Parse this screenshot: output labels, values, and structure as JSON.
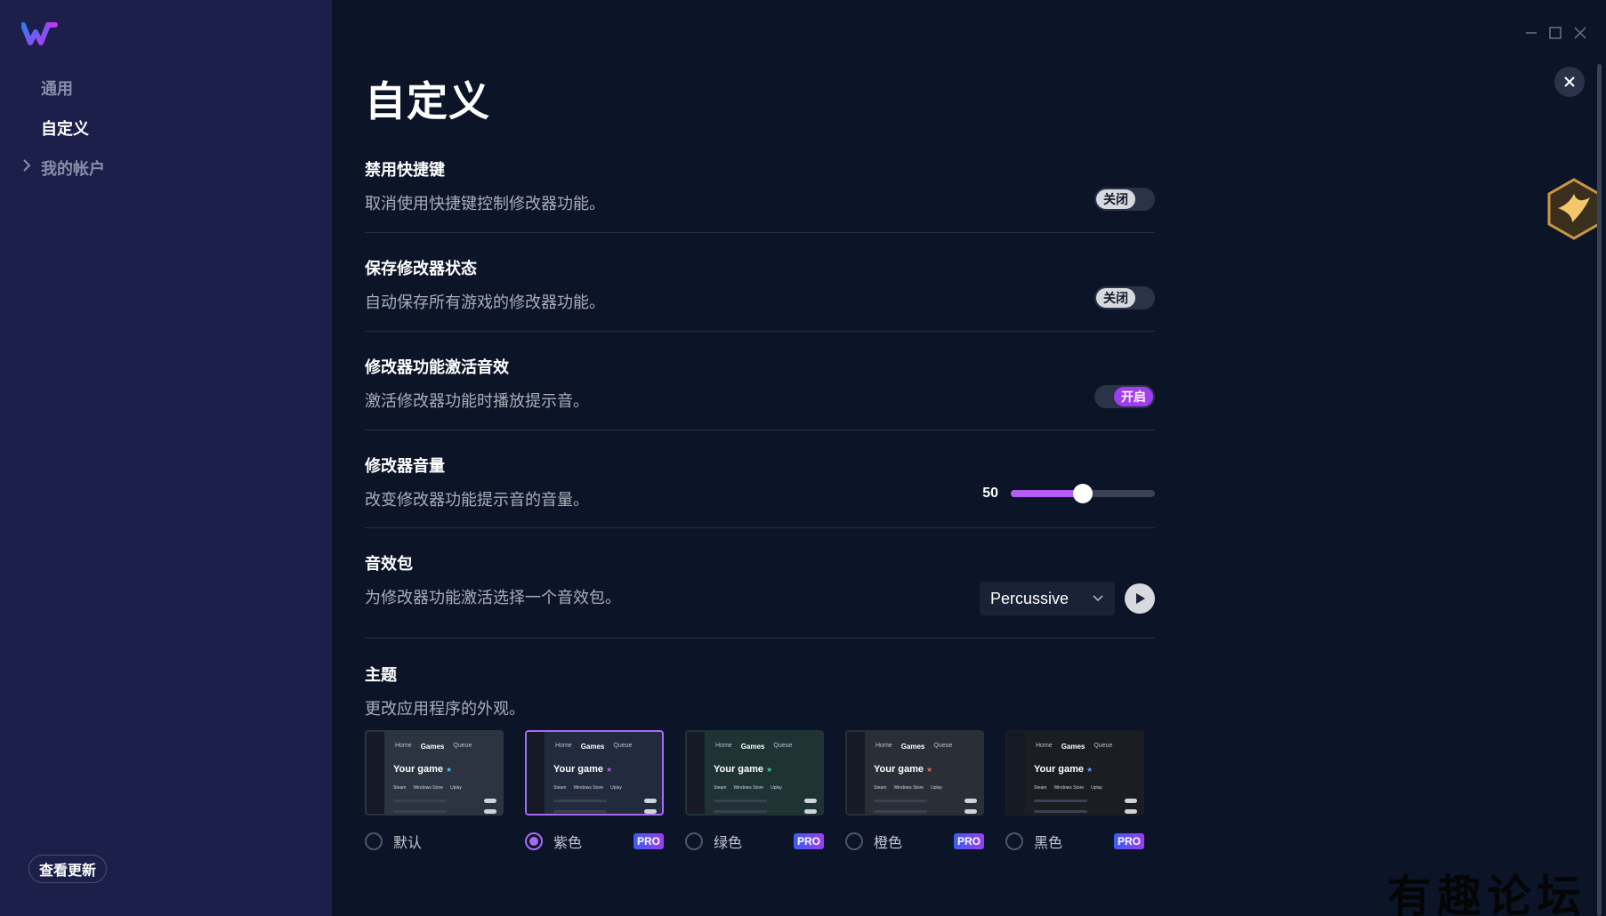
{
  "sidebar": {
    "items": [
      {
        "label": "通用"
      },
      {
        "label": "自定义"
      },
      {
        "label": "我的帐户"
      }
    ],
    "update_button": "查看更新"
  },
  "page": {
    "title": "自定义"
  },
  "settings": {
    "hotkeys": {
      "title": "禁用快捷键",
      "desc": "取消使用快捷键控制修改器功能。",
      "toggle": "关闭"
    },
    "save_state": {
      "title": "保存修改器状态",
      "desc": "自动保存所有游戏的修改器功能。",
      "toggle": "关闭"
    },
    "sound": {
      "title": "修改器功能激活音效",
      "desc": "激活修改器功能时播放提示音。",
      "toggle": "开启"
    },
    "volume": {
      "title": "修改器音量",
      "desc": "改变修改器功能提示音的音量。",
      "value": "50",
      "level": 0.5
    },
    "sound_pack": {
      "title": "音效包",
      "desc": "为修改器功能激活选择一个音效包。",
      "selected": "Percussive"
    },
    "theme": {
      "title": "主题",
      "desc": "更改应用程序的外观。"
    }
  },
  "theme_preview": {
    "nav": [
      "Home",
      "Games",
      "Queue"
    ],
    "title": "Your game",
    "tabs": [
      "Steam",
      "Windows Store",
      "Uplay"
    ]
  },
  "themes": [
    {
      "label": "默认",
      "pro": "",
      "accent": "#4fc3f7",
      "bg": "#2b3440"
    },
    {
      "label": "紫色",
      "pro": "PRO",
      "accent": "#b35cf2",
      "bg": "#222a3e"
    },
    {
      "label": "绿色",
      "pro": "PRO",
      "accent": "#2ed3a0",
      "bg": "#1f3335"
    },
    {
      "label": "橙色",
      "pro": "PRO",
      "accent": "#ff5a5a",
      "bg": "#2a2f37"
    },
    {
      "label": "黑色",
      "pro": "PRO",
      "accent": "#4fa3f7",
      "bg": "#1b1d22"
    }
  ],
  "watermark": "有趣论坛"
}
